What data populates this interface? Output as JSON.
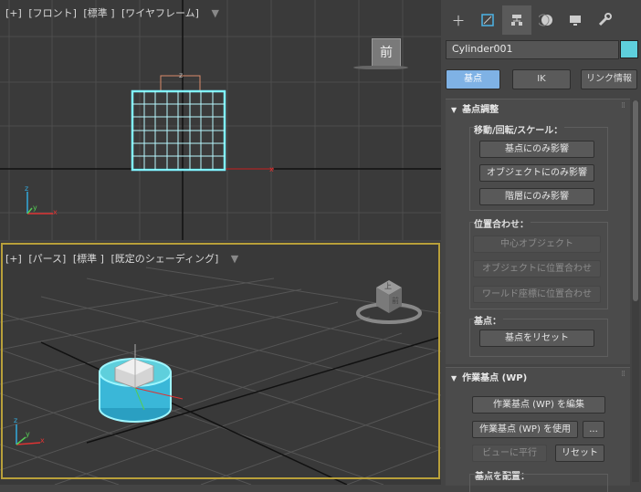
{
  "viewports": {
    "front": {
      "label_plus": "[+]",
      "label_view": "[フロント]",
      "label_shading": "[標準 ]",
      "label_mode": "[ワイヤフレーム]",
      "cube_face": "前"
    },
    "perspective": {
      "label_plus": "[+]",
      "label_view": "[パース]",
      "label_shading": "[標準 ]",
      "label_mode": "[既定のシェーディング]",
      "cube_face_top": "上",
      "cube_face_front": "前"
    }
  },
  "axis_labels": {
    "x": "x",
    "y": "y",
    "z": "z"
  },
  "panel": {
    "tab_icons": [
      "create-icon",
      "modify-icon",
      "hierarchy-icon",
      "motion-icon",
      "display-icon",
      "utilities-icon"
    ],
    "object_name": "Cylinder001",
    "object_color": "#5ecfdc",
    "modes": [
      "基点",
      "IK",
      "リンク情報"
    ],
    "active_mode": "基点",
    "adjust_pivot": {
      "title": "基点調整",
      "move_group_label": "移動/回転/スケール：",
      "buttons": [
        "基点にのみ影響",
        "オブジェクトにのみ影響",
        "階層にのみ影響"
      ],
      "align_label": "位置合わせ：",
      "align_buttons": [
        "中心オブジェクト",
        "オブジェクトに位置合わせ",
        "ワールド座標に位置合わせ"
      ],
      "pivot_label": "基点：",
      "reset_button": "基点をリセット"
    },
    "working_pivot": {
      "title": "作業基点 (WP)",
      "edit_button": "作業基点 (WP) を編集",
      "use_button": "作業基点 (WP) を使用",
      "more_button": "...",
      "align_view_button": "ビューに平行",
      "reset_button": "リセット",
      "place_label": "基点を配置："
    }
  },
  "colors": {
    "wire": "#7ff2ff",
    "accent": "#7fb2e5",
    "active_frame": "#b9a03a"
  }
}
